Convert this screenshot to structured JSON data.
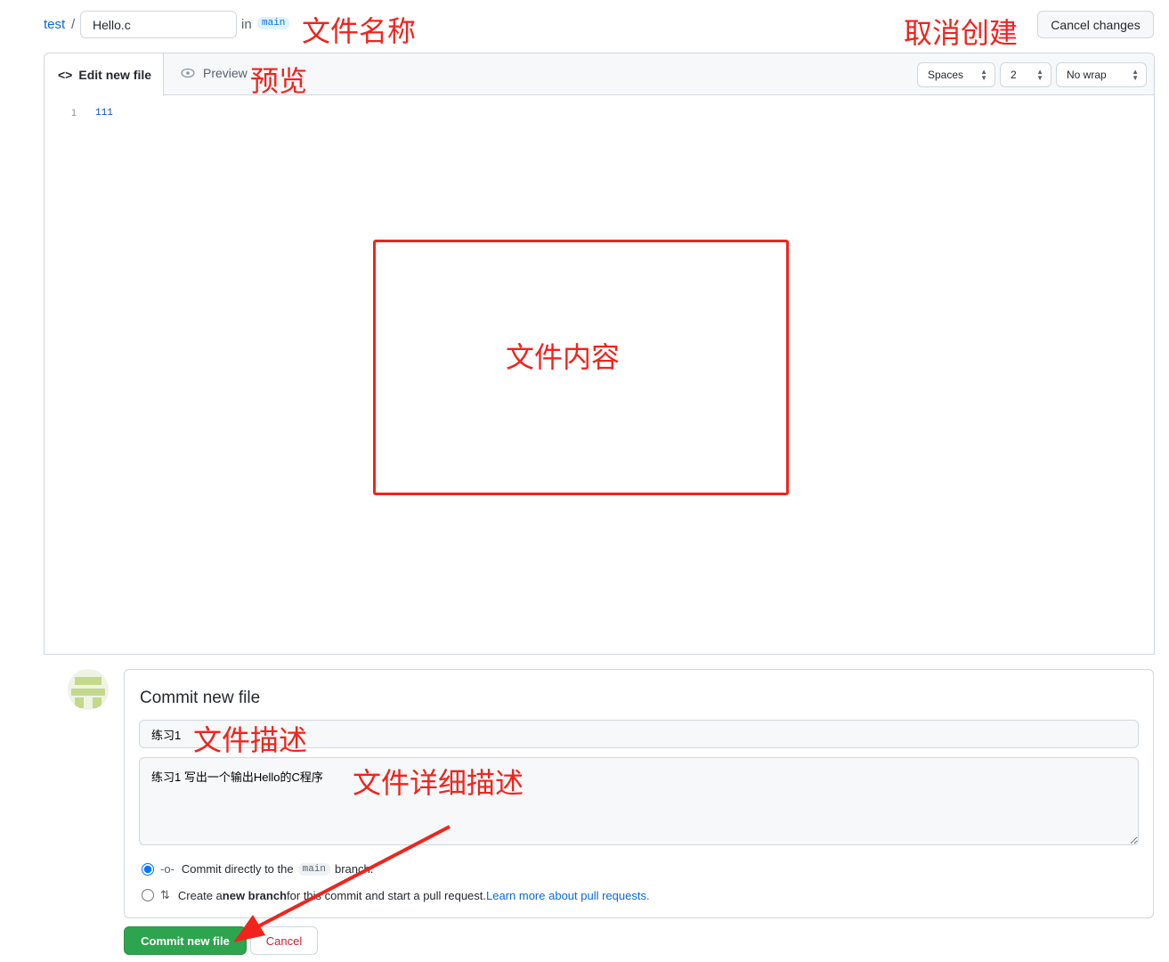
{
  "header": {
    "repo": "test",
    "separator": "/",
    "filename": "Hello.c",
    "in_label": "in",
    "branch": "main",
    "cancel_changes": "Cancel changes"
  },
  "editor": {
    "tab_edit": "Edit new file",
    "tab_preview": "Preview",
    "indent_mode": "Spaces",
    "indent_size": "2",
    "wrap_mode": "No wrap",
    "lines": [
      {
        "number": "1",
        "text": "111"
      }
    ]
  },
  "commit": {
    "title": "Commit new file",
    "summary": "练习1",
    "description": "练习1 写出一个输出Hello的C程序",
    "option_direct_pre": "Commit directly to the",
    "option_direct_branch": "main",
    "option_direct_post": "branch.",
    "option_new_pre": "Create a",
    "option_new_bold": "new branch",
    "option_new_post": "for this commit and start a pull request.",
    "learn_more": "Learn more about pull requests.",
    "submit": "Commit new file",
    "cancel": "Cancel",
    "selected_option": "direct"
  },
  "annotations": {
    "filename": "文件名称",
    "cancel": "取消创建",
    "preview": "预览",
    "content": "文件内容",
    "summary": "文件描述",
    "description": "文件详细描述",
    "color": "#f0241c"
  }
}
